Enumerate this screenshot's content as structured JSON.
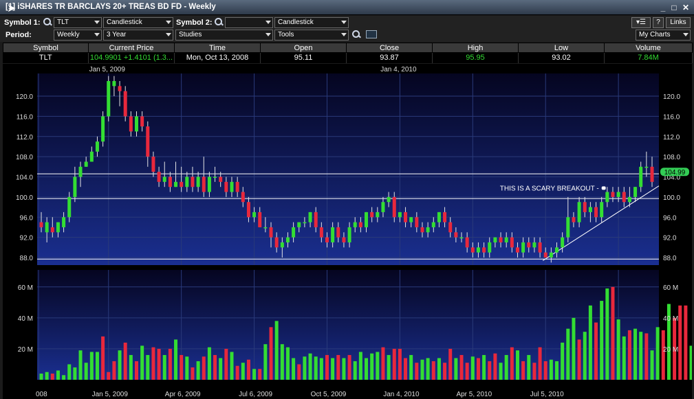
{
  "window": {
    "title": "[1] iSHARES TR BARCLAYS 20+ TREAS BD FD - Weekly",
    "min": "_",
    "max": "□",
    "close": "✕"
  },
  "toolbar": {
    "symbol1_label": "Symbol 1:",
    "symbol1_value": "TLT",
    "type1": "Candlestick",
    "symbol2_label": "Symbol 2:",
    "symbol2_value": "",
    "type2": "Candlestick",
    "period_label": "Period:",
    "period_value": "Weekly",
    "range_value": "3 Year",
    "studies_label": "Studies",
    "tools_label": "Tools",
    "help_label": "?",
    "links_label": "Links",
    "mycharts_label": "My Charts"
  },
  "quote": {
    "headers": [
      "Symbol",
      "Current Price",
      "Time",
      "Open",
      "Close",
      "High",
      "Low",
      "Volume"
    ],
    "values": [
      "TLT",
      "104.9901 +1.4101 (1.3...",
      "Mon, Oct 13, 2008",
      "95.11",
      "93.87",
      "95.95",
      "93.02",
      "7.84M"
    ]
  },
  "colors": {
    "up": "#33dd33",
    "down": "#e8283c",
    "bg_top": "#050520",
    "bg_bot": "#1a2f90"
  },
  "chart_data": [
    {
      "type": "candlestick",
      "series": [
        {
          "values": [
            [
              95,
              94,
              97,
              93
            ],
            [
              93,
              95,
              96,
              91
            ],
            [
              94,
              93,
              96,
              92
            ],
            [
              93,
              95,
              95,
              92
            ],
            [
              94,
              96,
              97,
              93
            ],
            [
              96,
              100,
              101,
              95
            ],
            [
              100,
              104,
              106,
              99
            ],
            [
              104,
              106,
              107,
              102
            ],
            [
              106,
              107,
              108,
              106
            ],
            [
              107,
              109,
              110,
              107
            ],
            [
              109,
              111,
              112,
              108
            ],
            [
              111,
              116,
              117,
              110
            ],
            [
              116,
              123,
              124,
              115
            ],
            [
              122,
              123,
              124,
              120
            ],
            [
              122,
              121,
              123,
              118
            ],
            [
              121,
              116,
              122,
              115
            ],
            [
              116,
              113,
              117,
              112
            ],
            [
              113,
              116,
              117,
              112
            ],
            [
              116,
              114,
              117,
              113
            ],
            [
              114,
              108,
              115,
              106
            ],
            [
              108,
              105,
              109,
              104
            ],
            [
              105,
              103,
              106,
              102
            ],
            [
              103,
              104,
              107,
              102
            ],
            [
              104,
              102,
              105,
              101
            ],
            [
              102,
              103,
              107,
              102
            ],
            [
              103,
              102,
              106,
              101
            ],
            [
              102,
              104,
              105,
              101
            ],
            [
              104,
              102,
              106,
              101
            ],
            [
              102,
              104,
              105,
              101
            ],
            [
              104,
              101,
              108,
              100
            ],
            [
              101,
              104,
              105,
              100
            ],
            [
              104,
              104,
              106,
              103
            ],
            [
              104,
              103,
              105,
              102
            ],
            [
              103,
              101,
              104,
              100
            ],
            [
              101,
              103,
              104,
              100
            ],
            [
              103,
              101,
              104,
              100
            ],
            [
              101,
              99,
              102,
              98
            ],
            [
              99,
              96,
              100,
              95
            ],
            [
              96,
              97,
              98,
              95
            ],
            [
              97,
              94,
              98,
              94
            ],
            [
              94,
              94,
              96,
              93
            ],
            [
              94,
              92,
              95,
              90
            ],
            [
              92,
              90,
              93,
              89
            ],
            [
              90,
              91,
              92,
              88
            ],
            [
              91,
              92,
              93,
              90
            ],
            [
              92,
              94,
              95,
              91
            ],
            [
              94,
              95,
              95,
              93
            ],
            [
              95,
              95,
              96,
              94
            ],
            [
              95,
              97,
              97,
              94
            ],
            [
              97,
              94,
              98,
              93
            ],
            [
              94,
              92,
              95,
              91
            ],
            [
              92,
              91,
              93,
              90
            ],
            [
              91,
              94,
              95,
              90
            ],
            [
              94,
              92,
              95,
              91
            ],
            [
              92,
              91,
              93,
              90
            ],
            [
              91,
              94,
              95,
              90
            ],
            [
              94,
              95,
              96,
              93
            ],
            [
              95,
              94,
              96,
              93
            ],
            [
              94,
              97,
              97,
              93
            ],
            [
              97,
              96,
              98,
              95
            ],
            [
              96,
              97,
              98,
              95
            ],
            [
              97,
              99,
              100,
              96
            ],
            [
              99,
              100,
              101,
              98
            ],
            [
              100,
              96,
              101,
              95
            ],
            [
              96,
              97,
              97,
              95
            ],
            [
              97,
              95,
              98,
              94
            ],
            [
              95,
              96,
              96,
              94
            ],
            [
              96,
              94,
              97,
              93
            ],
            [
              94,
              93,
              95,
              92
            ],
            [
              93,
              94,
              95,
              92
            ],
            [
              94,
              95,
              96,
              93
            ],
            [
              95,
              97,
              97,
              94
            ],
            [
              97,
              95,
              98,
              94
            ],
            [
              95,
              93,
              96,
              92
            ],
            [
              93,
              92,
              94,
              91
            ],
            [
              92,
              92,
              93,
              91
            ],
            [
              92,
              90,
              93,
              89
            ],
            [
              90,
              89,
              91,
              88
            ],
            [
              89,
              90,
              91,
              88
            ],
            [
              90,
              89,
              91,
              88
            ],
            [
              89,
              91,
              92,
              88
            ],
            [
              91,
              92,
              92,
              90
            ],
            [
              92,
              91,
              93,
              90
            ],
            [
              91,
              92,
              93,
              90
            ],
            [
              92,
              90,
              93,
              89
            ],
            [
              90,
              89,
              91,
              88
            ],
            [
              89,
              91,
              92,
              88
            ],
            [
              91,
              90,
              92,
              89
            ],
            [
              90,
              91,
              92,
              89
            ],
            [
              91,
              89,
              92,
              88
            ],
            [
              89,
              88,
              90,
              88
            ],
            [
              88,
              89,
              90,
              87
            ],
            [
              89,
              90,
              91,
              88
            ],
            [
              90,
              92,
              93,
              89
            ],
            [
              92,
              96,
              100,
              91
            ],
            [
              96,
              95,
              97,
              94
            ],
            [
              95,
              99,
              100,
              94
            ],
            [
              99,
              97,
              100,
              96
            ],
            [
              97,
              98,
              99,
              95
            ],
            [
              98,
              96,
              99,
              95
            ],
            [
              96,
              99,
              100,
              95
            ],
            [
              99,
              101,
              102,
              98
            ],
            [
              101,
              100,
              102,
              99
            ],
            [
              100,
              101,
              102,
              99
            ],
            [
              101,
              99,
              102,
              98
            ],
            [
              99,
              100,
              102,
              98
            ],
            [
              100,
              102,
              102,
              99
            ],
            [
              102,
              106,
              107,
              101
            ],
            [
              106,
              106,
              109,
              104
            ],
            [
              106,
              103,
              108,
              102
            ]
          ]
        }
      ],
      "volumes": [
        [
          4,
          1
        ],
        [
          5,
          1
        ],
        [
          4,
          0
        ],
        [
          6,
          1
        ],
        [
          3,
          1
        ],
        [
          10,
          1
        ],
        [
          8,
          1
        ],
        [
          19,
          1
        ],
        [
          11,
          1
        ],
        [
          18,
          1
        ],
        [
          18,
          1
        ],
        [
          28,
          0
        ],
        [
          5,
          0
        ],
        [
          12,
          0
        ],
        [
          19,
          1
        ],
        [
          24,
          0
        ],
        [
          16,
          1
        ],
        [
          12,
          0
        ],
        [
          22,
          1
        ],
        [
          16,
          1
        ],
        [
          21,
          0
        ],
        [
          20,
          0
        ],
        [
          16,
          1
        ],
        [
          20,
          0
        ],
        [
          26,
          1
        ],
        [
          16,
          0
        ],
        [
          15,
          1
        ],
        [
          8,
          0
        ],
        [
          12,
          1
        ],
        [
          15,
          0
        ],
        [
          21,
          1
        ],
        [
          16,
          0
        ],
        [
          14,
          1
        ],
        [
          20,
          0
        ],
        [
          18,
          1
        ],
        [
          9,
          0
        ],
        [
          11,
          1
        ],
        [
          13,
          0
        ],
        [
          7,
          1
        ],
        [
          7,
          0
        ],
        [
          23,
          1
        ],
        [
          34,
          0
        ],
        [
          38,
          1
        ],
        [
          23,
          1
        ],
        [
          21,
          1
        ],
        [
          14,
          1
        ],
        [
          10,
          0
        ],
        [
          15,
          1
        ],
        [
          17,
          1
        ],
        [
          15,
          1
        ],
        [
          14,
          1
        ],
        [
          16,
          0
        ],
        [
          14,
          1
        ],
        [
          16,
          0
        ],
        [
          14,
          1
        ],
        [
          16,
          0
        ],
        [
          12,
          1
        ],
        [
          18,
          1
        ],
        [
          14,
          1
        ],
        [
          17,
          1
        ],
        [
          18,
          1
        ],
        [
          21,
          0
        ],
        [
          16,
          1
        ],
        [
          20,
          0
        ],
        [
          20,
          0
        ],
        [
          14,
          0
        ],
        [
          16,
          1
        ],
        [
          11,
          0
        ],
        [
          13,
          1
        ],
        [
          14,
          1
        ],
        [
          12,
          0
        ],
        [
          14,
          1
        ],
        [
          11,
          0
        ],
        [
          20,
          0
        ],
        [
          14,
          1
        ],
        [
          16,
          0
        ],
        [
          11,
          0
        ],
        [
          15,
          1
        ],
        [
          14,
          0
        ],
        [
          16,
          1
        ],
        [
          12,
          0
        ],
        [
          17,
          0
        ],
        [
          11,
          1
        ],
        [
          16,
          1
        ],
        [
          21,
          0
        ],
        [
          19,
          1
        ],
        [
          12,
          0
        ],
        [
          16,
          1
        ],
        [
          11,
          0
        ],
        [
          21,
          0
        ],
        [
          12,
          0
        ],
        [
          13,
          1
        ],
        [
          12,
          1
        ],
        [
          24,
          1
        ],
        [
          33,
          1
        ],
        [
          40,
          1
        ],
        [
          26,
          0
        ],
        [
          31,
          1
        ],
        [
          48,
          1
        ],
        [
          37,
          0
        ],
        [
          51,
          1
        ],
        [
          59,
          1
        ],
        [
          60,
          0
        ],
        [
          39,
          1
        ],
        [
          28,
          1
        ],
        [
          32,
          0
        ],
        [
          33,
          1
        ],
        [
          31,
          1
        ],
        [
          30,
          0
        ],
        [
          19,
          1
        ],
        [
          34,
          1
        ],
        [
          32,
          0
        ],
        [
          49,
          1
        ],
        [
          40,
          0
        ],
        [
          48,
          0
        ],
        [
          48,
          0
        ],
        [
          22,
          1
        ]
      ],
      "yticks": [
        88,
        92,
        96,
        100,
        104,
        108,
        112,
        116,
        120
      ],
      "ylabels": [
        "88.0",
        "92.0",
        "96.0",
        "100.0",
        "104.0",
        "108.0",
        "112.0",
        "116.0",
        "120.0"
      ],
      "top_date_labels": [
        "Jan 5, 2009",
        "Jan 4, 2010"
      ],
      "current_price_tag": "104.99",
      "hlines": [
        104.6,
        99.7,
        87.7
      ],
      "annotation": "THIS IS A SCARY BREAKOUT -"
    },
    {
      "type": "bar",
      "yticks": [
        20,
        40,
        60
      ],
      "ylabels": [
        "20 M",
        "40 M",
        "60 M"
      ],
      "xticks": [
        "008",
        "Jan 5, 2009",
        "Apr 6, 2009",
        "Jul 6, 2009",
        "Oct 5, 2009",
        "Jan 4, 2010",
        "Apr 5, 2010",
        "Jul 5, 2010"
      ]
    }
  ]
}
